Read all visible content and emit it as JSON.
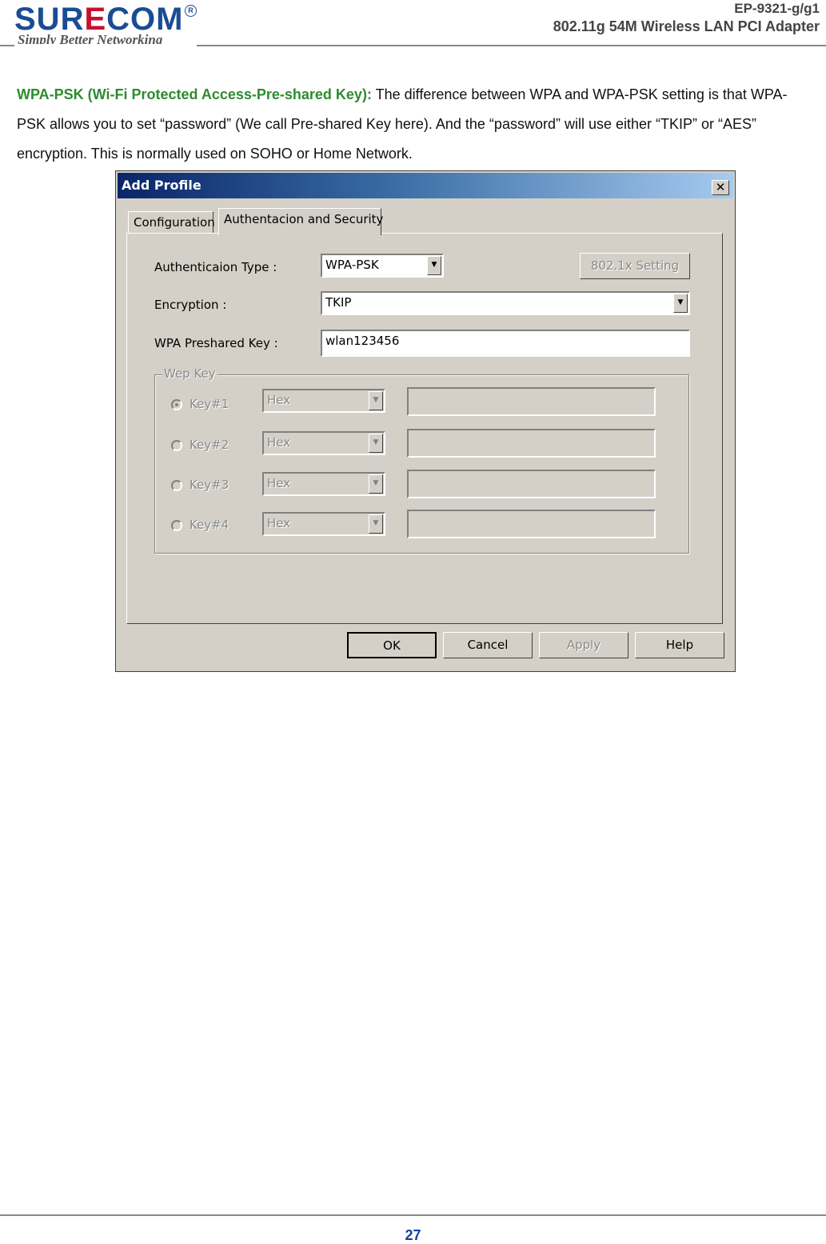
{
  "header": {
    "logo_main": "SURECOM",
    "logo_tagline": "Simply Better Networking",
    "model": "EP-9321-g/g1",
    "product": "802.11g  54M  Wireless  LAN  PCI  Adapter"
  },
  "paragraph": {
    "term": "WPA-PSK (Wi-Fi Protected Access-Pre-shared Key):",
    "text": " The difference between WPA and WPA-PSK setting is that WPA-PSK allows you to set “password” (We call Pre-shared Key here). And the “password” will use either “TKIP” or “AES” encryption. This is normally used on SOHO or Home Network."
  },
  "dialog": {
    "title": "Add Profile",
    "close_glyph": "✕",
    "tabs": [
      "Configuration",
      "Authentacion and Security"
    ],
    "auth_type_label": "Authenticaion Type :",
    "auth_type_value": "WPA-PSK",
    "setting_button": "802.1x Setting",
    "encryption_label": "Encryption :",
    "encryption_value": "TKIP",
    "psk_label": "WPA Preshared Key :",
    "psk_value": "wlan123456",
    "wep_group_title": "Wep Key",
    "wep_keys": [
      {
        "label": "Key#1",
        "format": "Hex",
        "selected": true
      },
      {
        "label": "Key#2",
        "format": "Hex",
        "selected": false
      },
      {
        "label": "Key#3",
        "format": "Hex",
        "selected": false
      },
      {
        "label": "Key#4",
        "format": "Hex",
        "selected": false
      }
    ],
    "buttons": {
      "ok": "OK",
      "cancel": "Cancel",
      "apply": "Apply",
      "help": "Help"
    },
    "dropdown_glyph": "▼"
  },
  "footer": {
    "page_number": "27"
  }
}
